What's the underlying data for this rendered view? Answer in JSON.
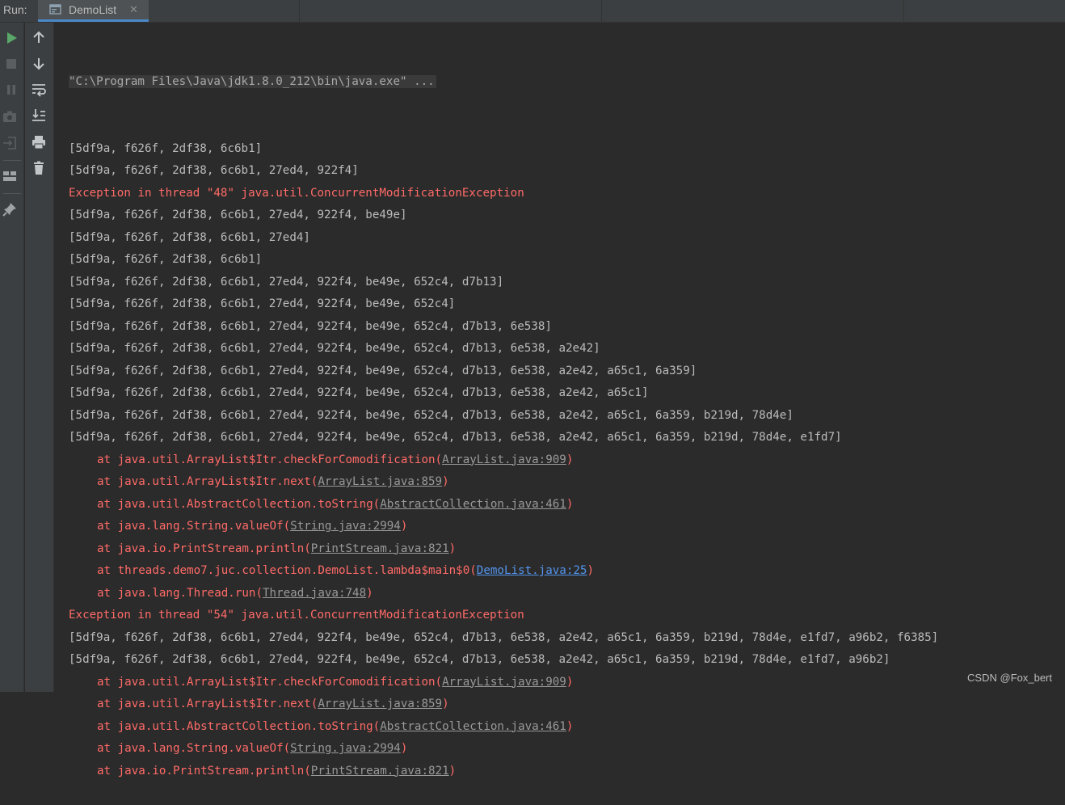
{
  "header": {
    "run_label": "Run:",
    "tab_label": "DemoList",
    "tab_close": "✕"
  },
  "colors": {
    "error": "#ff6b68",
    "link": "#5394ec",
    "run_green": "#59a869"
  },
  "console": {
    "command": "\"C:\\Program Files\\Java\\jdk1.8.0_212\\bin\\java.exe\" ...",
    "lines": [
      {
        "t": "out",
        "text": "[5df9a, f626f, 2df38, 6c6b1]"
      },
      {
        "t": "out",
        "text": "[5df9a, f626f, 2df38, 6c6b1, 27ed4, 922f4]"
      },
      {
        "t": "err",
        "text": "Exception in thread \"48\" java.util.ConcurrentModificationException"
      },
      {
        "t": "out",
        "text": "[5df9a, f626f, 2df38, 6c6b1, 27ed4, 922f4, be49e]"
      },
      {
        "t": "out",
        "text": "[5df9a, f626f, 2df38, 6c6b1, 27ed4]"
      },
      {
        "t": "out",
        "text": "[5df9a, f626f, 2df38, 6c6b1]"
      },
      {
        "t": "out",
        "text": "[5df9a, f626f, 2df38, 6c6b1, 27ed4, 922f4, be49e, 652c4, d7b13]"
      },
      {
        "t": "out",
        "text": "[5df9a, f626f, 2df38, 6c6b1, 27ed4, 922f4, be49e, 652c4]"
      },
      {
        "t": "out",
        "text": "[5df9a, f626f, 2df38, 6c6b1, 27ed4, 922f4, be49e, 652c4, d7b13, 6e538]"
      },
      {
        "t": "out",
        "text": "[5df9a, f626f, 2df38, 6c6b1, 27ed4, 922f4, be49e, 652c4, d7b13, 6e538, a2e42]"
      },
      {
        "t": "out",
        "text": "[5df9a, f626f, 2df38, 6c6b1, 27ed4, 922f4, be49e, 652c4, d7b13, 6e538, a2e42, a65c1, 6a359]"
      },
      {
        "t": "out",
        "text": "[5df9a, f626f, 2df38, 6c6b1, 27ed4, 922f4, be49e, 652c4, d7b13, 6e538, a2e42, a65c1]"
      },
      {
        "t": "out",
        "text": "[5df9a, f626f, 2df38, 6c6b1, 27ed4, 922f4, be49e, 652c4, d7b13, 6e538, a2e42, a65c1, 6a359, b219d, 78d4e]"
      },
      {
        "t": "out",
        "text": "[5df9a, f626f, 2df38, 6c6b1, 27ed4, 922f4, be49e, 652c4, d7b13, 6e538, a2e42, a65c1, 6a359, b219d, 78d4e, e1fd7]"
      },
      {
        "t": "at",
        "pre": "at java.util.ArrayList$Itr.checkForComodification(",
        "link": "ArrayList.java:909",
        "post": ")"
      },
      {
        "t": "at",
        "pre": "at java.util.ArrayList$Itr.next(",
        "link": "ArrayList.java:859",
        "post": ")"
      },
      {
        "t": "at",
        "pre": "at java.util.AbstractCollection.toString(",
        "link": "AbstractCollection.java:461",
        "post": ")"
      },
      {
        "t": "at",
        "pre": "at java.lang.String.valueOf(",
        "link": "String.java:2994",
        "post": ")"
      },
      {
        "t": "at",
        "pre": "at java.io.PrintStream.println(",
        "link": "PrintStream.java:821",
        "post": ")"
      },
      {
        "t": "at",
        "pre": "at threads.demo7.juc.collection.DemoList.lambda$main$0(",
        "link": "DemoList.java:25",
        "post": ")",
        "blue": true
      },
      {
        "t": "at",
        "pre": "at java.lang.Thread.run(",
        "link": "Thread.java:748",
        "post": ")"
      },
      {
        "t": "err",
        "text": "Exception in thread \"54\" java.util.ConcurrentModificationException"
      },
      {
        "t": "out",
        "text": "[5df9a, f626f, 2df38, 6c6b1, 27ed4, 922f4, be49e, 652c4, d7b13, 6e538, a2e42, a65c1, 6a359, b219d, 78d4e, e1fd7, a96b2, f6385]"
      },
      {
        "t": "out",
        "text": "[5df9a, f626f, 2df38, 6c6b1, 27ed4, 922f4, be49e, 652c4, d7b13, 6e538, a2e42, a65c1, 6a359, b219d, 78d4e, e1fd7, a96b2]"
      },
      {
        "t": "at",
        "pre": "at java.util.ArrayList$Itr.checkForComodification(",
        "link": "ArrayList.java:909",
        "post": ")"
      },
      {
        "t": "at",
        "pre": "at java.util.ArrayList$Itr.next(",
        "link": "ArrayList.java:859",
        "post": ")"
      },
      {
        "t": "at",
        "pre": "at java.util.AbstractCollection.toString(",
        "link": "AbstractCollection.java:461",
        "post": ")"
      },
      {
        "t": "at",
        "pre": "at java.lang.String.valueOf(",
        "link": "String.java:2994",
        "post": ")"
      },
      {
        "t": "at",
        "pre": "at java.io.PrintStream.println(",
        "link": "PrintStream.java:821",
        "post": ")"
      }
    ]
  },
  "watermark": "CSDN @Fox_bert"
}
